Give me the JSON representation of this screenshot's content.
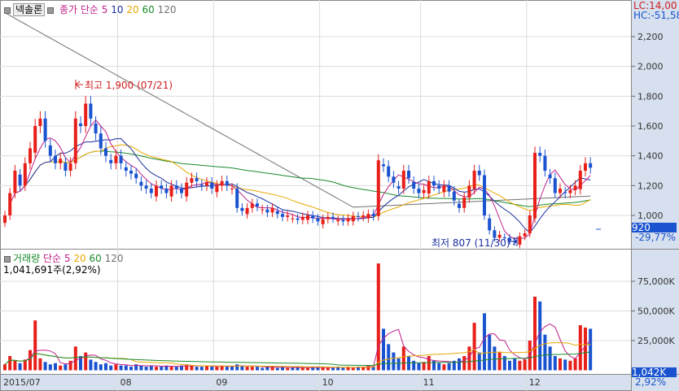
{
  "header": {
    "stock_name": "넥솔론",
    "price_legend": "종가 단순",
    "ma_periods": [
      "5",
      "10",
      "20",
      "60",
      "120"
    ],
    "lc": "LC:14,00",
    "hc": "HC:-51,58"
  },
  "volume_header": {
    "label": "거래량",
    "ma_label": "단순",
    "ma_periods": [
      "5",
      "20",
      "60",
      "120"
    ],
    "current": "1,041,691주(2,92%)"
  },
  "annotations": {
    "high": "최고 1,900 (07/21)",
    "low": "최저 807 (11/30)"
  },
  "price_badge": {
    "value": "920",
    "change": "-29,77%"
  },
  "volume_badge": {
    "value": "1,042K",
    "change": "2,92%"
  },
  "colors": {
    "up": "#e8201a",
    "down": "#1a53d0",
    "ma5": "#c0208a",
    "ma10": "#1a2fa0",
    "ma20": "#e8a800",
    "ma60": "#1a8a2a",
    "ma120": "#707070",
    "axis_bg": "#d6e0ee"
  },
  "chart_data": {
    "type": "candlestick",
    "price_ticks": [
      "2,200",
      "2,000",
      "1,800",
      "1,600",
      "1,400",
      "1,200",
      "1,000"
    ],
    "price_tick_values": [
      2200,
      2000,
      1800,
      1600,
      1400,
      1200,
      1000
    ],
    "volume_ticks": [
      "75,000K",
      "50,000K",
      "25,000K"
    ],
    "volume_tick_values": [
      75000,
      50000,
      25000
    ],
    "x_labels": [
      {
        "label": "2015/07",
        "index": 0
      },
      {
        "label": "08",
        "index": 23
      },
      {
        "label": "09",
        "index": 42
      },
      {
        "label": "10",
        "index": 63
      },
      {
        "label": "11",
        "index": 83
      },
      {
        "label": "12",
        "index": 104
      }
    ],
    "close": [
      1000,
      1150,
      1300,
      1200,
      1350,
      1450,
      1600,
      1650,
      1500,
      1400,
      1350,
      1380,
      1300,
      1350,
      1650,
      1600,
      1750,
      1650,
      1550,
      1450,
      1400,
      1350,
      1400,
      1350,
      1300,
      1280,
      1250,
      1200,
      1180,
      1150,
      1200,
      1180,
      1150,
      1200,
      1180,
      1150,
      1220,
      1250,
      1230,
      1200,
      1220,
      1180,
      1200,
      1230,
      1200,
      1180,
      1050,
      1030,
      1050,
      1080,
      1060,
      1040,
      1020,
      1050,
      1010,
      990,
      1000,
      980,
      970,
      990,
      1000,
      980,
      960,
      975,
      990,
      980,
      970,
      960,
      980,
      995,
      990,
      1000,
      1010,
      995,
      1370,
      1330,
      1260,
      1220,
      1180,
      1300,
      1250,
      1180,
      1150,
      1170,
      1230,
      1200,
      1180,
      1200,
      1160,
      1100,
      1050,
      1120,
      1200,
      1300,
      1270,
      1000,
      900,
      850,
      870,
      850,
      830,
      820,
      860,
      880,
      1000,
      1420,
      1400,
      1300,
      1250,
      1150,
      1180,
      1150,
      1170,
      1200,
      1300,
      1350,
      1320
    ],
    "volume_k": [
      5000,
      12000,
      8000,
      6000,
      9000,
      17000,
      42000,
      10000,
      7000,
      5000,
      6000,
      4000,
      5000,
      8000,
      20000,
      12000,
      15000,
      9000,
      7000,
      5000,
      6000,
      4000,
      5000,
      4000,
      4000,
      3000,
      5000,
      4000,
      3000,
      4000,
      3000,
      3000,
      4000,
      3000,
      3000,
      4000,
      5000,
      4000,
      3000,
      3000,
      4000,
      3000,
      3000,
      4000,
      3000,
      3000,
      5000,
      4000,
      3000,
      3000,
      3000,
      2000,
      3000,
      3000,
      2000,
      3000,
      2000,
      2000,
      3000,
      2000,
      2000,
      3000,
      2000,
      3000,
      2000,
      2000,
      3000,
      2000,
      3000,
      2000,
      3000,
      3000,
      4000,
      3000,
      90000,
      35000,
      22000,
      15000,
      10000,
      20000,
      12000,
      8000,
      6000,
      7000,
      12000,
      8000,
      6000,
      5000,
      6000,
      8000,
      10000,
      12000,
      20000,
      40000,
      15000,
      48000,
      30000,
      20000,
      15000,
      12000,
      8000,
      10000,
      8000,
      9000,
      25000,
      62000,
      58000,
      30000,
      20000,
      12000,
      10000,
      9000,
      8000,
      10000,
      38000,
      36000,
      35000
    ],
    "ma120_anchors": [
      [
        0,
        2360
      ],
      [
        69,
        1055
      ],
      [
        116,
        1130
      ]
    ],
    "ylim": [
      800,
      2400
    ]
  }
}
